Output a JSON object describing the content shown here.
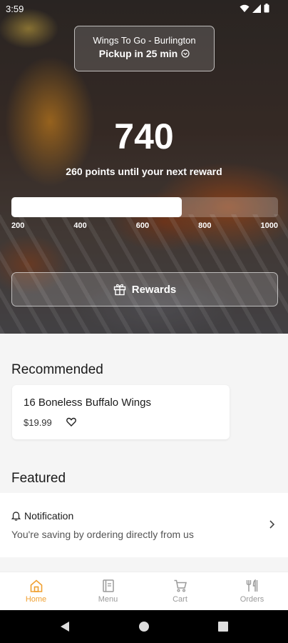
{
  "status_bar": {
    "time": "3:59"
  },
  "store": {
    "name": "Wings To Go - Burlington",
    "pickup": "Pickup in 25 min"
  },
  "rewards": {
    "points": "740",
    "caption": "260 points until your next reward",
    "progress_fraction": 0.64,
    "ticks": [
      "200",
      "400",
      "600",
      "800",
      "1000"
    ],
    "button_label": "Rewards"
  },
  "recommended": {
    "title": "Recommended",
    "items": [
      {
        "name": "16 Boneless Buffalo Wings",
        "price": "$19.99"
      }
    ]
  },
  "featured": {
    "title": "Featured",
    "notification": {
      "title": "Notification",
      "body": "You're saving by ordering directly from us"
    }
  },
  "bottom_nav": {
    "items": [
      {
        "label": "Home",
        "icon": "home-icon",
        "active": true
      },
      {
        "label": "Menu",
        "icon": "menu-icon",
        "active": false
      },
      {
        "label": "Cart",
        "icon": "cart-icon",
        "active": false
      },
      {
        "label": "Orders",
        "icon": "orders-icon",
        "active": false
      }
    ]
  },
  "colors": {
    "accent": "#f0a030",
    "inactive": "#9a9a9a"
  }
}
